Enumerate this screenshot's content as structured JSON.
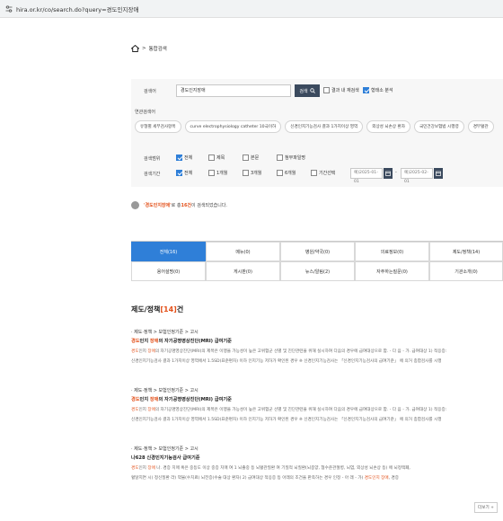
{
  "address_bar": {
    "url": "hira.or.kr/co/search.do?query=경도인지장애"
  },
  "breadcrumb": {
    "label": "통합검색"
  },
  "search": {
    "label": "검색어",
    "query": "경도인지장애",
    "button": "검색",
    "within_results": "결과 내 재검색",
    "morpheme": "형태소 분석",
    "related_label": "연관검색어",
    "related": [
      "유형별 세부검사항목",
      "curve electrophysiology catheter 10극이하",
      "신경인지기능검사 결과 1가지이상 영역",
      "외상성 뇌손상 환자",
      "국민건강보험법 시행령",
      "경부혈관"
    ],
    "scope_label": "검색범위",
    "scope_options": [
      "전체",
      "제목",
      "본문",
      "첨부파일명"
    ],
    "period_label": "검색기간",
    "period_options": [
      "전체",
      "1개월",
      "3개월",
      "6개월",
      "기간선택"
    ],
    "date_from": "예)2025-01-01",
    "date_to": "예)2025-02-01"
  },
  "summary": {
    "q": "'경도인지장애'",
    "mid": "로 총 ",
    "count": "16건",
    "tail": "이 검색되었습니다."
  },
  "tabs": [
    {
      "label": "전체(16)",
      "active": true
    },
    {
      "label": "메뉴(0)"
    },
    {
      "label": "병원/약국(0)"
    },
    {
      "label": "의료정보(0)"
    },
    {
      "label": "제도/정책(14)"
    },
    {
      "label": "용어설명(0)"
    },
    {
      "label": "게시판(0)"
    },
    {
      "label": "뉴스/알림(2)"
    },
    {
      "label": "자주하는질문(0)"
    },
    {
      "label": "기관소개(0)"
    }
  ],
  "section": {
    "title": "제도/정책",
    "count": "[14]",
    "suffix": "건"
  },
  "results": [
    {
      "path": "· 제도·정책 > 보험인정기준 > 고시",
      "title_hl": "경도",
      "title_mid": "인지 ",
      "title_hl2": "장애",
      "title_rest": "의 자기공명영상진단(MRI) 급여기준",
      "line1_hl": "경도",
      "line1_a": "인지 ",
      "line1_hl2": "장애",
      "line1_b": "의 자기공명영상진단(MRI)의 제목은 이행을 가능성이 높은 고위험군 선별 및 진단관련을 위해 실시하여 다음의 경우에 급여대상으로 함. - 다 음 - 가. 급여대상 1) 적응증:",
      "line2": "신경인지기능검사 결과 1가지이상 영역에서 1.5SD(표준편차) 이하 인지기능 저하가 확인된 경우 ※ 신경인지기능검사는 「신경인지기능검사의 급여기준」 에 의거 종합검사를 시행"
    },
    {
      "path": "· 제도·정책 > 보험인정기준 > 고시",
      "title_hl": "경도",
      "title_mid": "인지 ",
      "title_hl2": "장애",
      "title_rest": "의 자기공명영상진단(MRI) 급여기준",
      "line1_hl": "경도",
      "line1_a": "인지 ",
      "line1_hl2": "장애",
      "line1_b": "의 자기공명영상진단(MRI)의 제목은 이행을 가능성이 높은 고위험군 선별 및 진단관련을 위해 실시하여 다음의 경우에 급여대상으로 함. - 다 음 - 가. 급여대상 1) 적응증:",
      "line2": "신경인지기능검사 결과 1가지이상 영역에서 1.5SD(표준편차) 이하 인지기능 저하가 확인된 경우 ※ 신경인지기능검사는 「신경인지기능검사의 급여기준」 에 의거 종합검사를 시행"
    },
    {
      "path": "· 제도·정책 > 보험인정기준 > 고시",
      "title_plain": "나628 신경인지기능검사 급여기준",
      "line1_hl": "경도",
      "line1_a": "인지 ",
      "line1_hl2": "장애",
      "line1_b": " 나. 경증 치매 혹은 중등도 이상 중증 치매 여 1 뇌졸중 등 뇌혈관질환 여 기질적 뇌질환(뇌종양, 협수준관절병, 뇌염, 외상성 뇌손상 등) 에 뇌정맥폐,",
      "line2_a": "혈달지면 시) 정신질환 라) 약물(수치료) 뇌전증(수술 대상 환자) 2) 급여대상 적응증 등 아래의 조건을 판족하는 경우 인정 - 아 래 - 가) ",
      "line2_hl": "경도인지 장애",
      "line2_b": ", 경증"
    }
  ],
  "more_button": "더보기 +"
}
